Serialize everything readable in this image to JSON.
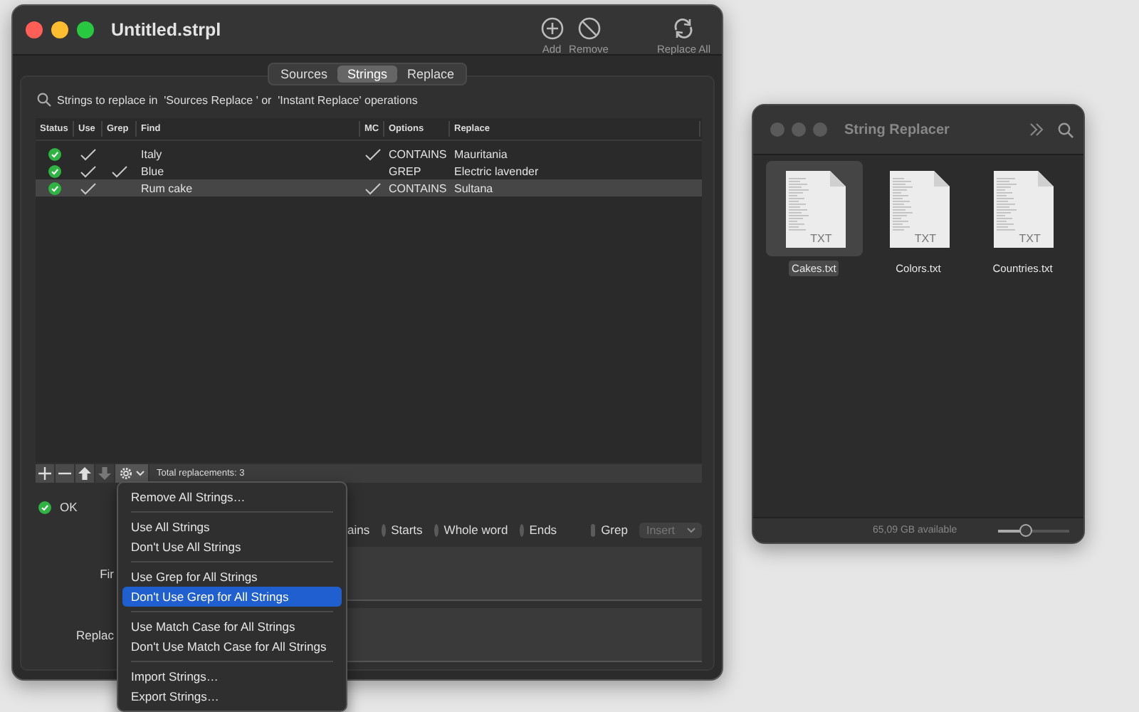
{
  "main_window": {
    "title": "Untitled.strpl",
    "toolbar": [
      {
        "kind": "add",
        "label": "Add"
      },
      {
        "kind": "remove",
        "label": "Remove"
      },
      {
        "kind": "spacer"
      },
      {
        "kind": "replace",
        "label": "Replace All"
      }
    ],
    "tabs": [
      {
        "label": "Sources",
        "selected": false
      },
      {
        "label": "Strings",
        "selected": true
      },
      {
        "label": "Replace",
        "selected": false
      }
    ],
    "hint": "Strings to replace in  'Sources Replace ' or  'Instant Replace' operations",
    "table": {
      "columns": [
        "Status",
        "Use",
        "Grep",
        "Find",
        "MC",
        "Options",
        "Replace"
      ],
      "rows": [
        {
          "status_ok": true,
          "use": true,
          "grep": false,
          "find": "Italy",
          "mc": true,
          "options": "CONTAINS",
          "replace": "Mauritania",
          "selected": false
        },
        {
          "status_ok": true,
          "use": true,
          "grep": true,
          "find": "Blue",
          "mc": false,
          "options": "GREP",
          "replace": "Electric lavender",
          "selected": false
        },
        {
          "status_ok": true,
          "use": true,
          "grep": false,
          "find": "Rum cake",
          "mc": true,
          "options": "CONTAINS",
          "replace": "Sultana",
          "selected": true
        }
      ]
    },
    "table_toolbar": {
      "buttons": [
        {
          "kind": "plus",
          "disabled": false
        },
        {
          "kind": "minus",
          "disabled": false
        },
        {
          "kind": "up",
          "disabled": false
        },
        {
          "kind": "down",
          "disabled": true
        },
        {
          "kind": "gear",
          "disabled": false
        }
      ],
      "summary": "Total replacements: 3"
    },
    "status": {
      "ok": true,
      "text": "OK"
    },
    "options_row": {
      "partial_label": "ains",
      "radios": [
        {
          "label": "Starts",
          "selected": false
        },
        {
          "label": "Whole word",
          "selected": false
        },
        {
          "label": "Ends",
          "selected": false
        }
      ],
      "grep": {
        "label": "Grep",
        "checked": false
      },
      "insert": {
        "label": "Insert",
        "disabled": true
      }
    },
    "fields": [
      {
        "label": "Fir"
      },
      {
        "label": "Replac"
      }
    ],
    "menu": [
      {
        "kind": "item",
        "label": "Remove All Strings…",
        "selected": false
      },
      {
        "kind": "separator"
      },
      {
        "kind": "item",
        "label": "Use All Strings",
        "selected": false
      },
      {
        "kind": "item",
        "label": "Don't Use All Strings",
        "selected": false
      },
      {
        "kind": "separator"
      },
      {
        "kind": "item",
        "label": "Use Grep for All Strings",
        "selected": false
      },
      {
        "kind": "item",
        "label": "Don't Use Grep for All Strings",
        "selected": true
      },
      {
        "kind": "separator"
      },
      {
        "kind": "item",
        "label": "Use Match Case for All Strings",
        "selected": false
      },
      {
        "kind": "item",
        "label": "Don't Use Match Case for All Strings",
        "selected": false
      },
      {
        "kind": "separator"
      },
      {
        "kind": "item",
        "label": "Import Strings…",
        "selected": false
      },
      {
        "kind": "item",
        "label": "Export Strings…",
        "selected": false
      }
    ]
  },
  "finder_window": {
    "title": "String Replacer",
    "files": [
      {
        "name": "Cakes.txt",
        "type": "TXT",
        "selected": true
      },
      {
        "name": "Colors.txt",
        "type": "TXT",
        "selected": false
      },
      {
        "name": "Countries.txt",
        "type": "TXT",
        "selected": false
      }
    ],
    "footer": "65,09 GB available",
    "zoom_slider": {
      "level": 0.4
    }
  }
}
